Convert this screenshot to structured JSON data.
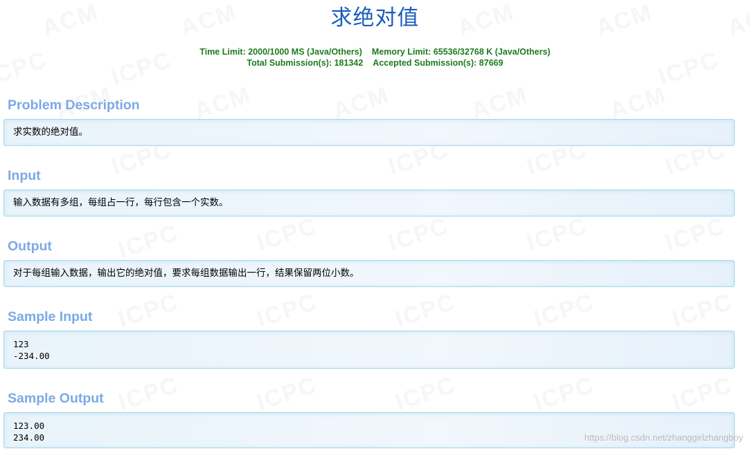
{
  "problem": {
    "title": "求绝对值",
    "stats": {
      "time_limit": "Time Limit: 2000/1000 MS (Java/Others)",
      "memory_limit": "Memory Limit: 65536/32768 K (Java/Others)",
      "total_submissions": "Total Submission(s): 181342",
      "accepted_submissions": "Accepted Submission(s): 87669"
    }
  },
  "sections": {
    "description": {
      "heading": "Problem Description",
      "text": "求实数的绝对值。"
    },
    "input": {
      "heading": "Input",
      "text": "输入数据有多组，每组占一行，每行包含一个实数。"
    },
    "output": {
      "heading": "Output",
      "text": "对于每组输入数据，输出它的绝对值，要求每组数据输出一行，结果保留两位小数。"
    },
    "sample_input": {
      "heading": "Sample Input",
      "lines": [
        "123",
        "-234.00"
      ]
    },
    "sample_output": {
      "heading": "Sample Output",
      "lines": [
        "123.00",
        "234.00"
      ]
    }
  },
  "watermarks": {
    "background_a": "ACM",
    "background_b": "ICPC",
    "footer": "https://blog.csdn.net/zhanggirlzhangboy"
  },
  "colors": {
    "title": "#1a5cbf",
    "stats": "#1e7a1e",
    "section_heading": "#7ca9e6",
    "panel_border": "#9fd8ec"
  }
}
